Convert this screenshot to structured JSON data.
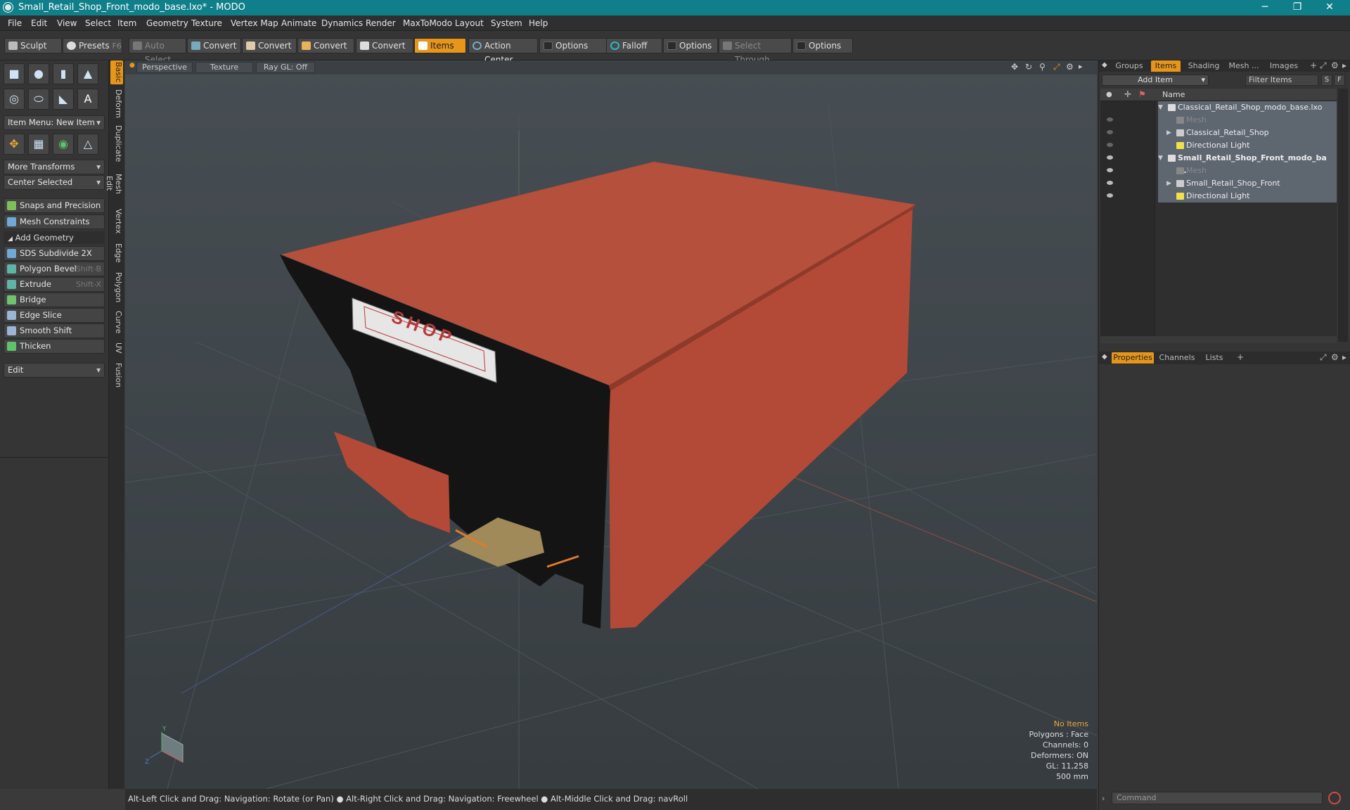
{
  "window": {
    "title": "Small_Retail_Shop_Front_modo_base.lxo* - MODO",
    "minimize": "─",
    "maximize": "❐",
    "close": "✕"
  },
  "menu": [
    "File",
    "Edit",
    "View",
    "Select",
    "Item",
    "Geometry",
    "Texture",
    "Vertex Map",
    "Animate",
    "Dynamics",
    "Render",
    "MaxToModo",
    "Layout",
    "System",
    "Help"
  ],
  "toolbar": {
    "sculpt": "Sculpt",
    "presets": "Presets",
    "presets_shortcut": "F6",
    "auto_select": "Auto Select",
    "convert1": "Convert",
    "convert2": "Convert",
    "convert3": "Convert",
    "convert4": "Convert",
    "items": "Items",
    "action_center": "Action Center",
    "options1": "Options",
    "falloff": "Falloff",
    "options2": "Options",
    "select_through": "Select Through",
    "options3": "Options"
  },
  "left_panel": {
    "item_menu": "Item Menu: New Item",
    "more_transforms": "More Transforms",
    "center_selected": "Center Selected",
    "snaps": "Snaps and Precision",
    "mesh_constraints": "Mesh Constraints",
    "add_geometry": "Add Geometry",
    "tools": [
      {
        "label": "SDS Subdivide 2X",
        "shortcut": ""
      },
      {
        "label": "Polygon Bevel",
        "shortcut": "Shift-B"
      },
      {
        "label": "Extrude",
        "shortcut": "Shift-X"
      },
      {
        "label": "Bridge",
        "shortcut": ""
      },
      {
        "label": "Edge Slice",
        "shortcut": ""
      },
      {
        "label": "Smooth Shift",
        "shortcut": ""
      },
      {
        "label": "Thicken",
        "shortcut": ""
      }
    ],
    "edit_dropdown": "Edit",
    "vertical_tabs": [
      "Basic",
      "Deform",
      "Duplicate",
      "Mesh Edit",
      "Vertex",
      "Edge",
      "Polygon",
      "Curve",
      "UV",
      "Fusion"
    ]
  },
  "viewport": {
    "view": "Perspective",
    "shading": "Texture",
    "raygl": "Ray GL: Off",
    "sign_text": "SHOP",
    "info": {
      "items": "No Items",
      "polygons": "Polygons : Face",
      "channels": "Channels: 0",
      "deformers": "Deformers: ON",
      "gl": "GL: 11,258",
      "scale": "500 mm"
    },
    "axis_y": "Y",
    "axis_z": "Z",
    "colors": {
      "roof": "#b5503c",
      "wall": "#b24a37",
      "front": "#141414",
      "sign": "#e6e6e6",
      "sign_text": "#b83a3a",
      "floor": "#a08a5a"
    }
  },
  "status": "Alt-Left Click and Drag: Navigation: Rotate (or Pan) ● Alt-Right Click and Drag: Navigation: Freewheel ● Alt-Middle Click and Drag: navRoll",
  "right_panel": {
    "tabs": [
      "Groups",
      "Items",
      "Shading",
      "Mesh ...",
      "Images"
    ],
    "add_item": "Add Item",
    "filter_items": "Filter Items",
    "filter_s": "S",
    "filter_f": "F",
    "col_name": "Name",
    "tree": [
      {
        "label": "Classical_Retail_Shop_modo_base.lxo",
        "indent": 0,
        "style": "",
        "icon": "scene-icon"
      },
      {
        "label": "Mesh",
        "indent": 1,
        "style": "dim",
        "icon": "mesh-icon"
      },
      {
        "label": "Classical_Retail_Shop",
        "indent": 1,
        "style": "",
        "icon": "group-icon"
      },
      {
        "label": "Directional Light",
        "indent": 1,
        "style": "",
        "icon": "light-icon"
      },
      {
        "label": "Small_Retail_Shop_Front_modo_ba ...",
        "indent": 0,
        "style": "bold",
        "icon": "scene-icon"
      },
      {
        "label": "Mesh",
        "indent": 1,
        "style": "dim",
        "icon": "mesh-icon"
      },
      {
        "label": "Small_Retail_Shop_Front",
        "indent": 1,
        "style": "",
        "icon": "group-icon"
      },
      {
        "label": "Directional Light",
        "indent": 1,
        "style": "",
        "icon": "light-icon"
      }
    ],
    "bottom_tabs": [
      "Properties",
      "Channels",
      "Lists"
    ],
    "command_placeholder": "Command"
  }
}
